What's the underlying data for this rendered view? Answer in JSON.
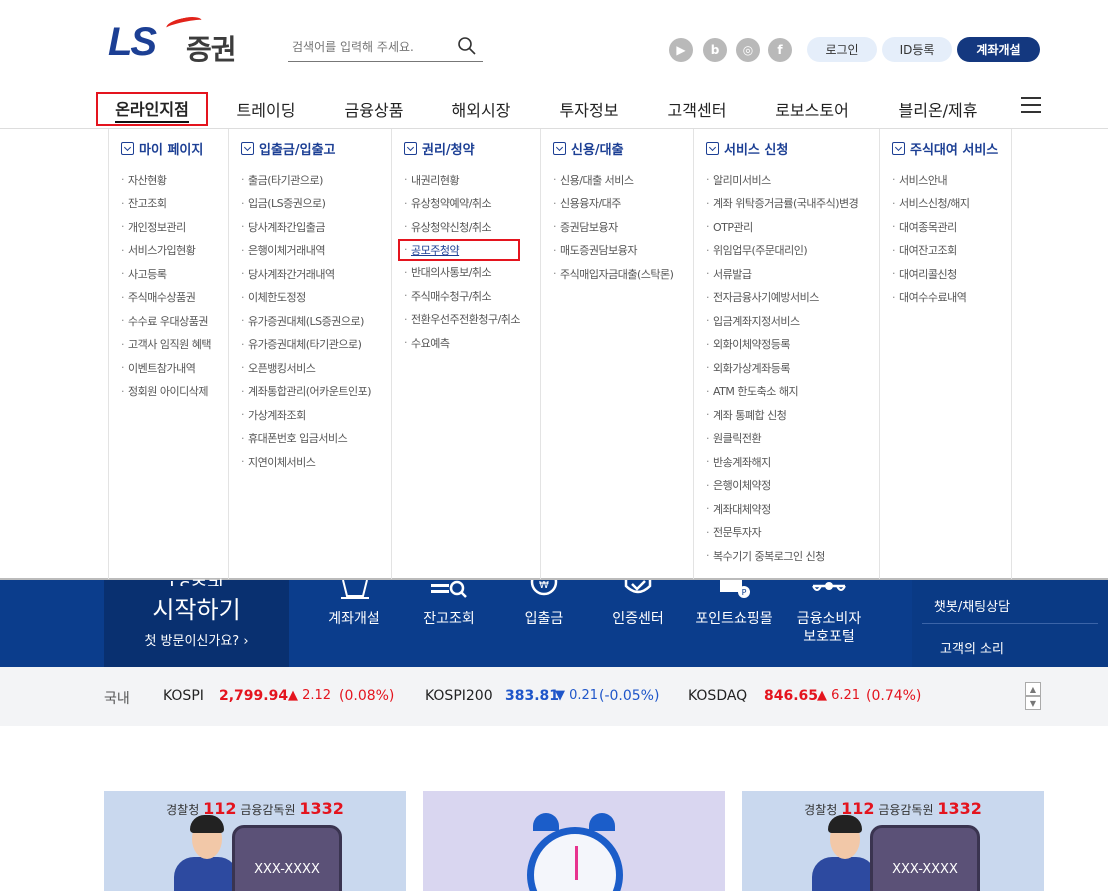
{
  "header": {
    "logo_ls": "LS",
    "logo_ko": "증권",
    "search_placeholder": "검색어를 입력해 주세요.",
    "sns": [
      "youtube-icon",
      "blog-icon",
      "instagram-icon",
      "facebook-icon"
    ],
    "sns_glyphs": [
      "▶",
      "b",
      "◎",
      "f"
    ],
    "login": "로그인",
    "register": "ID등록",
    "open_account": "계좌개설"
  },
  "gnb": [
    "온라인지점",
    "트레이딩",
    "금융상품",
    "해외시장",
    "투자정보",
    "고객센터",
    "로보스토어",
    "블리온/제휴"
  ],
  "menu": {
    "my_page": {
      "title": "마이 페이지",
      "items": [
        "자산현황",
        "잔고조회",
        "개인정보관리",
        "서비스가입현황",
        "사고등록",
        "주식매수상품권",
        "수수료 우대상품권",
        "고객사 임직원 혜택",
        "이벤트참가내역",
        "정회원 아이디삭제"
      ]
    },
    "transfer": {
      "title": "입출금/입출고",
      "items": [
        "출금(타기관으로)",
        "입금(LS증권으로)",
        "당사계좌간입출금",
        "은행이체거래내역",
        "당사계좌간거래내역",
        "이체한도정정",
        "유가증권대체(LS증권으로)",
        "유가증권대체(타기관으로)",
        "오픈뱅킹서비스",
        "계좌통합관리(어카운트인포)",
        "가상계좌조회",
        "휴대폰번호 입금서비스",
        "지연이체서비스"
      ]
    },
    "rights": {
      "title": "권리/청약",
      "items": [
        "내권리현황",
        "유상청약예약/취소",
        "유상청약신청/취소",
        "공모주청약",
        "반대의사통보/취소",
        "주식매수청구/취소",
        "전환우선주전환청구/취소",
        "수요예측"
      ]
    },
    "credit": {
      "title": "신용/대출",
      "items": [
        "신용/대출 서비스",
        "신용융자/대주",
        "증권담보융자",
        "매도증권담보융자",
        "주식매입자금대출(스탁론)"
      ]
    },
    "service": {
      "title": "서비스 신청",
      "items": [
        "알리미서비스",
        "계좌 위탁증거금률(국내주식)변경",
        "OTP관리",
        "위임업무(주문대리인)",
        "서류발급",
        "전자금융사기예방서비스",
        "입금계좌지정서비스",
        "외화이체약정등록",
        "외화가상계좌등록",
        "ATM 한도축소 해지",
        "계좌 통폐합 신청",
        "원클릭전환",
        "반송계좌해지",
        "은행이체약정",
        "계좌대체약정",
        "전문투자자",
        "복수기기 중복로그인 신청"
      ]
    },
    "lending": {
      "title": "주식대여 서비스",
      "items": [
        "서비스안내",
        "서비스신청/해지",
        "대여종목관리",
        "대여잔고조회",
        "대여리콜신청",
        "대여수수료내역"
      ]
    }
  },
  "banner": {
    "top": "LS증권",
    "title": "시작하기",
    "subtitle": "첫 방문이신가요? ›",
    "quick": [
      "계좌개설",
      "잔고조회",
      "입출금",
      "인증센터",
      "포인트쇼핑몰",
      "금융소비자\n보호포털"
    ],
    "chatbot": "챗봇/채팅상담",
    "voice": "고객의 소리"
  },
  "ticker": {
    "region": "국내",
    "kospi": {
      "name": "KOSPI",
      "value": "2,799.94",
      "change": "▲ 2.12",
      "pct": "(0.08%)"
    },
    "kospi200": {
      "name": "KOSPI200",
      "value": "383.81",
      "change": "▼ 0.21",
      "pct": "(-0.05%)"
    },
    "kosdaq": {
      "name": "KOSDAQ",
      "value": "846.65",
      "change": "▲ 6.21",
      "pct": "(0.74%)"
    }
  },
  "cards": {
    "police_label": "경찰청",
    "police_num": "112",
    "fss_label": "금융감독원",
    "fss_num": "1332",
    "phone_num": "XXX-XXXX"
  }
}
